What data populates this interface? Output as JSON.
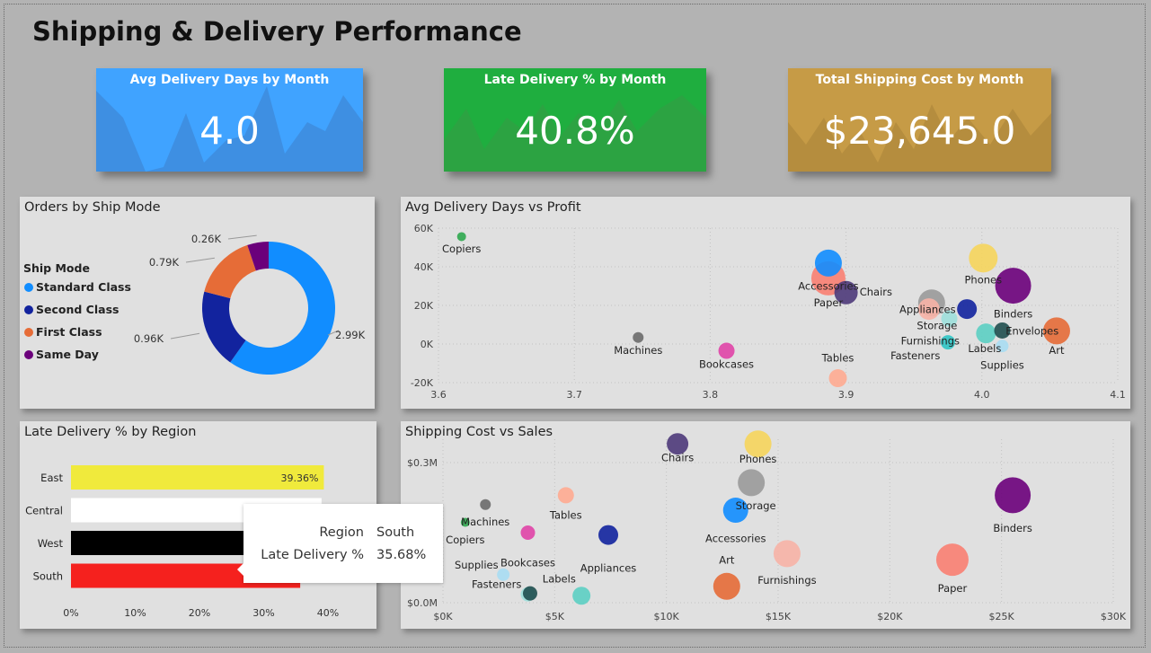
{
  "page_title": "Shipping & Delivery Performance",
  "kpis": [
    {
      "label": "Avg Delivery Days by Month",
      "value": "4.0",
      "color": "#40a3ff",
      "shade": "#3a8fe0"
    },
    {
      "label": "Late Delivery % by Month",
      "value": "40.8%",
      "color": "#1fae3f",
      "shade": "#2a9e46"
    },
    {
      "label": "Total Shipping Cost by Month",
      "value": "$23,645.0",
      "color": "#c69b46",
      "shade": "#b68c40"
    }
  ],
  "tooltip": {
    "key1": "Region",
    "val1": "South",
    "key2": "Late Delivery %",
    "val2": "35.68%"
  },
  "chart_data": [
    {
      "type": "pie",
      "title": "Orders by Ship Mode",
      "legend_title": "Ship Mode",
      "legend_position": "left",
      "donut": true,
      "slices": [
        {
          "name": "Standard Class",
          "value": 2.99,
          "label": "2.99K",
          "color": "#118dff"
        },
        {
          "name": "Second Class",
          "value": 0.96,
          "label": "0.96K",
          "color": "#12239e"
        },
        {
          "name": "First Class",
          "value": 0.79,
          "label": "0.79K",
          "color": "#e66c37"
        },
        {
          "name": "Same Day",
          "value": 0.26,
          "label": "0.26K",
          "color": "#6b007b"
        }
      ]
    },
    {
      "type": "scatter",
      "title": "Avg Delivery Days vs Profit",
      "xlim": [
        3.6,
        4.1
      ],
      "ylim": [
        -20000,
        60000
      ],
      "xticks": [
        "3.6",
        "3.7",
        "3.8",
        "3.9",
        "4.0",
        "4.1"
      ],
      "yticks": [
        "-20K",
        "0K",
        "20K",
        "40K",
        "60K"
      ],
      "grid": true,
      "points": [
        {
          "name": "Copiers",
          "x": 3.617,
          "y": 55600,
          "r": 5,
          "color": "#2fa84f"
        },
        {
          "name": "Machines",
          "x": 3.747,
          "y": 3400,
          "r": 6,
          "color": "#6b6b6b"
        },
        {
          "name": "Bookcases",
          "x": 3.812,
          "y": -3500,
          "r": 9,
          "color": "#e044a7"
        },
        {
          "name": "Tables",
          "x": 3.894,
          "y": -17700,
          "r": 10,
          "color": "#ffab91"
        },
        {
          "name": "Paper",
          "x": 3.887,
          "y": 34000,
          "r": 19,
          "color": "#fa8072"
        },
        {
          "name": "Accessories",
          "x": 3.887,
          "y": 41900,
          "r": 15,
          "color": "#118dff"
        },
        {
          "name": "Chairs",
          "x": 3.9,
          "y": 26600,
          "r": 13,
          "color": "#4e3a7a"
        },
        {
          "name": "Storage",
          "x": 3.963,
          "y": 21300,
          "r": 15,
          "color": "#9a9a9a"
        },
        {
          "name": "Appliances",
          "x": 3.961,
          "y": 18100,
          "r": 12,
          "color": "#f7b2a6"
        },
        {
          "name": "Furnishings",
          "x": 3.976,
          "y": 13100,
          "r": 9,
          "color": "#9de0dc"
        },
        {
          "name": "Fasteners",
          "x": 3.975,
          "y": 900,
          "r": 8,
          "color": "#2ec4c4"
        },
        {
          "name": "Labels",
          "x": 4.003,
          "y": 5500,
          "r": 11,
          "color": "#5ccfc3"
        },
        {
          "name": "Envelopes",
          "x": 4.015,
          "y": 7000,
          "r": 9,
          "color": "#1f4f4f"
        },
        {
          "name": "Supplies",
          "x": 4.015,
          "y": -1000,
          "r": 7,
          "color": "#a9ddf3"
        },
        {
          "name": "Phones",
          "x": 4.001,
          "y": 44500,
          "r": 16,
          "color": "#f6d55c"
        },
        {
          "name": "Binders",
          "x": 4.023,
          "y": 30200,
          "r": 20,
          "color": "#6b007b"
        },
        {
          "name": "Art",
          "x": 4.055,
          "y": 6800,
          "r": 15,
          "color": "#e66c37"
        },
        {
          "name": "Copiers2",
          "x": 3.989,
          "y": 18100,
          "r": 11,
          "color": "#12239e"
        }
      ],
      "labels": [
        {
          "text": "Copiers",
          "x": 3.617,
          "y": 47500
        },
        {
          "text": "Machines",
          "x": 3.747,
          "y": -5000
        },
        {
          "text": "Bookcases",
          "x": 3.812,
          "y": -12300
        },
        {
          "text": "Tables",
          "x": 3.894,
          "y": -9000
        },
        {
          "text": "Accessories",
          "x": 3.887,
          "y": 28200
        },
        {
          "text": "Paper",
          "x": 3.887,
          "y": 19600
        },
        {
          "text": "Chairs",
          "x": 3.922,
          "y": 25200
        },
        {
          "text": "Appliances",
          "x": 3.96,
          "y": 16000
        },
        {
          "text": "Storage",
          "x": 3.967,
          "y": 7700
        },
        {
          "text": "Furnishings",
          "x": 3.962,
          "y": -300
        },
        {
          "text": "Fasteners",
          "x": 3.951,
          "y": -8000
        },
        {
          "text": "Labels",
          "x": 4.002,
          "y": -4300
        },
        {
          "text": "Envelopes",
          "x": 4.037,
          "y": 4800
        },
        {
          "text": "Art",
          "x": 4.055,
          "y": -5000
        },
        {
          "text": "Supplies",
          "x": 4.015,
          "y": -12800
        },
        {
          "text": "Phones",
          "x": 4.001,
          "y": 31500
        },
        {
          "text": "Binders",
          "x": 4.023,
          "y": 13700
        }
      ]
    },
    {
      "type": "bar",
      "orientation": "horizontal",
      "title": "Late Delivery % by Region",
      "categories": [
        "East",
        "Central",
        "West",
        "South"
      ],
      "values": [
        39.36,
        39.0,
        39.0,
        35.68
      ],
      "colors": [
        "#f0ea3c",
        "#ffffff",
        "#000000",
        "#f5211e"
      ],
      "data_labels": [
        "39.36%",
        "",
        "",
        ""
      ],
      "xlim": [
        0,
        40
      ],
      "xticks": [
        "0%",
        "10%",
        "20%",
        "30%",
        "40%"
      ]
    },
    {
      "type": "scatter",
      "title": "Shipping Cost vs Sales",
      "xlim": [
        0,
        30000
      ],
      "ylim": [
        0,
        0.35
      ],
      "xticks": [
        "$0K",
        "$5K",
        "$10K",
        "$15K",
        "$20K",
        "$25K",
        "$30K"
      ],
      "yticks": [
        "$0.0M",
        "$0.3M"
      ],
      "ytick_values": [
        0,
        0.3
      ],
      "grid": true,
      "points": [
        {
          "name": "Chairs",
          "x": 10500,
          "y": 0.34,
          "r": 12,
          "color": "#4e3a7a"
        },
        {
          "name": "Phones",
          "x": 14100,
          "y": 0.34,
          "r": 15,
          "color": "#f6d55c"
        },
        {
          "name": "Storage",
          "x": 13800,
          "y": 0.257,
          "r": 15,
          "color": "#9a9a9a"
        },
        {
          "name": "Accessories",
          "x": 13100,
          "y": 0.198,
          "r": 14,
          "color": "#118dff"
        },
        {
          "name": "Art",
          "x": 12700,
          "y": 0.035,
          "r": 15,
          "color": "#e66c37"
        },
        {
          "name": "Furnishings",
          "x": 15400,
          "y": 0.105,
          "r": 15,
          "color": "#f7b2a6"
        },
        {
          "name": "Binders",
          "x": 25500,
          "y": 0.23,
          "r": 20,
          "color": "#6b007b"
        },
        {
          "name": "Paper",
          "x": 22800,
          "y": 0.092,
          "r": 18,
          "color": "#fa8072"
        },
        {
          "name": "Machines",
          "x": 1900,
          "y": 0.21,
          "r": 6,
          "color": "#6b6b6b"
        },
        {
          "name": "Copiers",
          "x": 1000,
          "y": 0.172,
          "r": 5,
          "color": "#2fa84f"
        },
        {
          "name": "Tables",
          "x": 5500,
          "y": 0.23,
          "r": 9,
          "color": "#ffab91"
        },
        {
          "name": "Bookcases",
          "x": 3800,
          "y": 0.15,
          "r": 8,
          "color": "#e044a7"
        },
        {
          "name": "Appliances",
          "x": 7400,
          "y": 0.145,
          "r": 11,
          "color": "#12239e"
        },
        {
          "name": "Supplies",
          "x": 2700,
          "y": 0.06,
          "r": 7,
          "color": "#a9ddf3"
        },
        {
          "name": "Fasteners",
          "x": 3800,
          "y": 0.018,
          "r": 8,
          "color": "#9de0dc"
        },
        {
          "name": "Labels",
          "x": 6200,
          "y": 0.015,
          "r": 10,
          "color": "#5ccfc3"
        },
        {
          "name": "Envelopes",
          "x": 3900,
          "y": 0.02,
          "r": 8,
          "color": "#1f4f4f"
        }
      ],
      "labels": [
        {
          "text": "Chairs",
          "x": 10500,
          "y": 0.303
        },
        {
          "text": "Phones",
          "x": 14100,
          "y": 0.3
        },
        {
          "text": "Storage",
          "x": 14000,
          "y": 0.2
        },
        {
          "text": "Accessories",
          "x": 13100,
          "y": 0.13
        },
        {
          "text": "Art",
          "x": 12700,
          "y": 0.084
        },
        {
          "text": "Furnishings",
          "x": 15400,
          "y": 0.04
        },
        {
          "text": "Binders",
          "x": 25500,
          "y": 0.152
        },
        {
          "text": "Paper",
          "x": 22800,
          "y": 0.023
        },
        {
          "text": "Machines",
          "x": 1900,
          "y": 0.165
        },
        {
          "text": "Copiers",
          "x": 1000,
          "y": 0.127
        },
        {
          "text": "Tables",
          "x": 5500,
          "y": 0.18
        },
        {
          "text": "Bookcases",
          "x": 3800,
          "y": 0.078
        },
        {
          "text": "Appliances",
          "x": 7400,
          "y": 0.066
        },
        {
          "text": "Supplies",
          "x": 1500,
          "y": 0.073
        },
        {
          "text": "Fasteners",
          "x": 2400,
          "y": 0.032
        },
        {
          "text": "Labels",
          "x": 5200,
          "y": 0.043
        }
      ]
    }
  ]
}
